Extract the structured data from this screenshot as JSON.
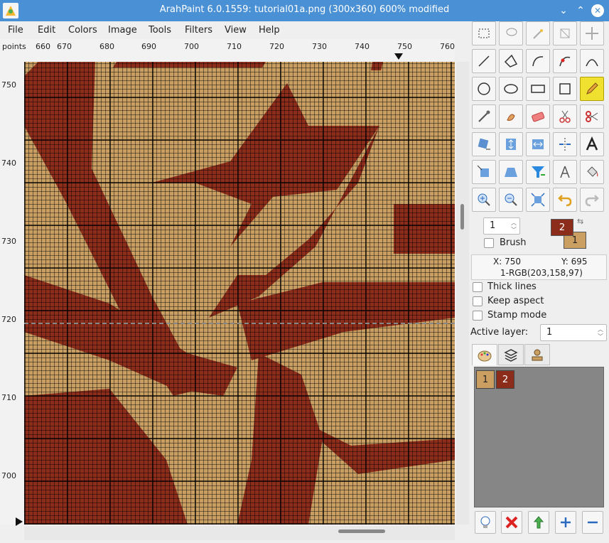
{
  "window": {
    "title": "ArahPaint 6.0.1559: tutorial01a.png (300x360) 600% modified",
    "minimize_glyph": "⌄",
    "maximize_glyph": "⌃",
    "close_glyph": "✕"
  },
  "menu": [
    "File",
    "Edit",
    "Colors",
    "Image",
    "Tools",
    "Filters",
    "View",
    "Help"
  ],
  "ruler": {
    "unit": "points",
    "h_ticks": [
      "660",
      "670",
      "680",
      "690",
      "700",
      "710",
      "720",
      "730",
      "740",
      "750",
      "760"
    ],
    "v_ticks": [
      "750",
      "740",
      "730",
      "720",
      "710",
      "700"
    ]
  },
  "colors": {
    "dark": "#8c2d1c",
    "light": "#cb9e61",
    "titlebar": "#4a90d4",
    "active_tool": "#f0e030"
  },
  "tools": [
    [
      "rect-select-icon",
      "lasso-icon",
      "magic-wand-icon",
      "crop-icon",
      "move-icon"
    ],
    [
      "line-icon",
      "polygon-icon",
      "curve-icon",
      "bezier-node-icon",
      "bezier-icon"
    ],
    [
      "circle-icon",
      "ellipse-icon",
      "rectangle-icon",
      "square-icon",
      "pencil-icon"
    ],
    [
      "eyedropper-icon",
      "smudge-icon",
      "eraser-icon",
      "cut-icon",
      "cut-red-icon"
    ],
    [
      "rotate-icon",
      "flip-vertical-icon",
      "flip-horizontal-icon",
      "mirror-icon",
      "text-icon"
    ],
    [
      "transform-icon",
      "perspective-icon",
      "filter-icon",
      "compass-icon",
      "fill-bucket-icon"
    ],
    [
      "zoom-in-icon",
      "zoom-out-icon",
      "fit-icon",
      "undo-icon",
      "redo-icon"
    ]
  ],
  "active_tool": "pencil-icon",
  "brush": {
    "size": "1",
    "label": "Brush"
  },
  "foreground_color_label": "2",
  "background_color_label": "1",
  "info": {
    "x": "X: 750",
    "y": "Y: 695",
    "color": "1-RGB(203,158,97)"
  },
  "options": {
    "thick_lines": "Thick lines",
    "keep_aspect": "Keep aspect",
    "stamp_mode": "Stamp mode"
  },
  "active_layer": {
    "label": "Active layer:",
    "value": "1"
  },
  "palette": [
    "1",
    "2"
  ],
  "panel_tabs": [
    "palette-tab-icon",
    "layers-tab-icon",
    "stamp-tab-icon"
  ],
  "bottom_buttons": [
    "light-bulb-icon",
    "delete-icon",
    "merge-icon",
    "add-icon",
    "remove-icon"
  ]
}
